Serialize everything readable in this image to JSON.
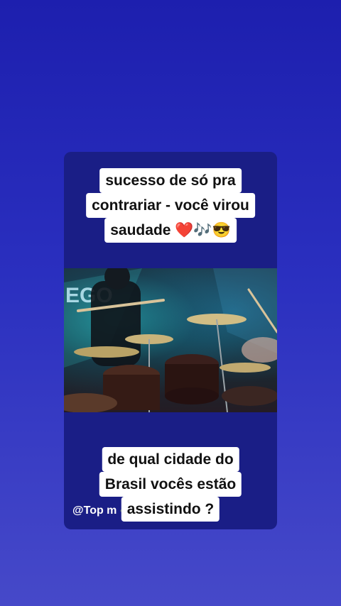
{
  "story": {
    "caption_top": {
      "line1": "sucesso de só pra",
      "line2": "contrariar - você virou",
      "line3": "saudade ❤️🎶😎"
    },
    "caption_bottom": {
      "line1": "de qual cidade do",
      "line2": "Brasil vocês estão",
      "line3": "assistindo ?"
    },
    "watermark": {
      "text": "@Top m",
      "icons": "🎶💗"
    },
    "video": {
      "sign_text": "EGO",
      "icon": "drum-kit-video"
    }
  }
}
